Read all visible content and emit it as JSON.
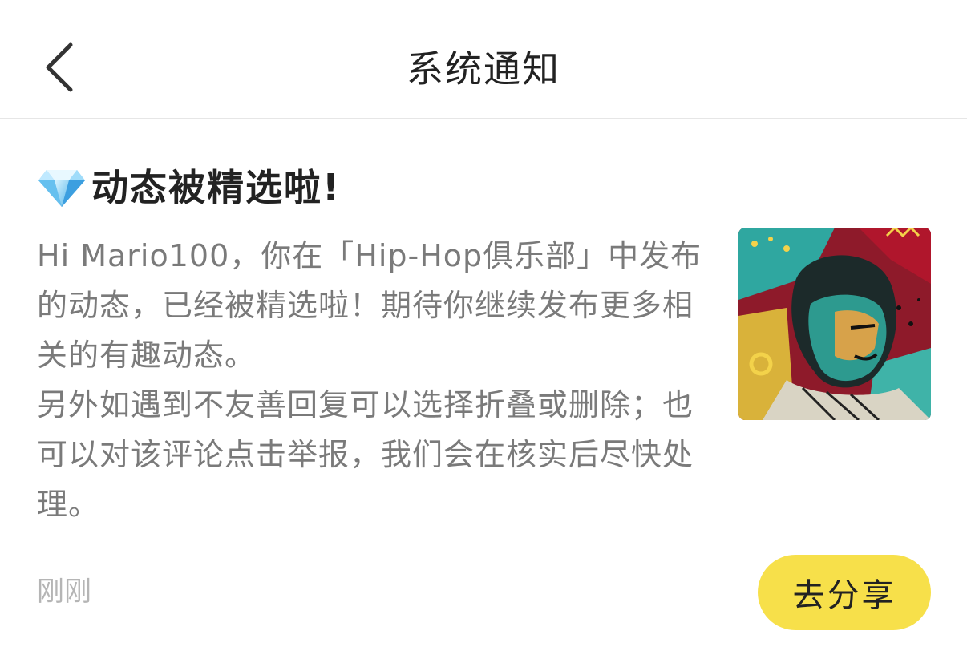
{
  "header": {
    "title": "系统通知",
    "back_icon": "chevron-left-icon"
  },
  "notice": {
    "icon": "diamond-icon",
    "title": "动态被精选啦!",
    "body_paragraphs": [
      "Hi Mario100，你在「Hip-Hop俱乐部」中发布的动态，已经被精选啦！期待你继续发布更多相关的有趣动态。",
      "另外如遇到不友善回复可以选择折叠或删除；也可以对该评论点击举报，我们会在核实后尽快处理。"
    ],
    "timestamp": "刚刚",
    "share_label": "去分享",
    "thumbnail": "hip-hop-portrait-illustration"
  },
  "colors": {
    "accent": "#f7e04a",
    "body_text": "#7a7a7a",
    "timestamp_text": "#b5b5b5",
    "title_text": "#222222"
  }
}
